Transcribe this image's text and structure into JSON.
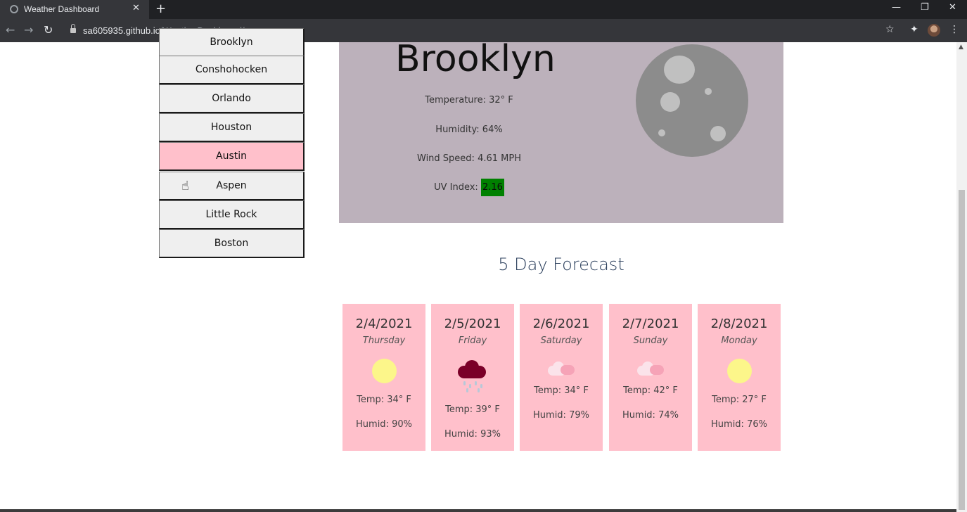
{
  "browser": {
    "tab_title": "Weather Dashboard",
    "tab_close": "✕",
    "new_tab": "+",
    "url_host": "sa605935.github.io",
    "url_path": "/WeatherDashboard/",
    "back": "←",
    "forward": "→",
    "reload": "↻",
    "star": "☆",
    "extensions": "✦",
    "menu": "⋮",
    "minimize": "—",
    "restore": "❐",
    "close": "✕"
  },
  "cities": [
    {
      "label": "Brooklyn"
    },
    {
      "label": "Conshohocken"
    },
    {
      "label": "Orlando"
    },
    {
      "label": "Houston"
    },
    {
      "label": "Austin",
      "active": true
    },
    {
      "label": "Aspen"
    },
    {
      "label": "Little Rock"
    },
    {
      "label": "Boston"
    }
  ],
  "current": {
    "city": "Brooklyn",
    "temperature": "Temperature: 32° F",
    "humidity": "Humidity: 64%",
    "wind": "Wind Speed: 4.61 MPH",
    "uv_label": "UV Index:",
    "uv_value": "2.16",
    "uv_color": "#008000",
    "icon": "moon-icon"
  },
  "forecast": {
    "title": "5 Day Forecast",
    "days": [
      {
        "date": "2/4/2021",
        "day": "Thursday",
        "icon": "sun-icon",
        "temp": "Temp: 34° F",
        "humid": "Humid: 90%"
      },
      {
        "date": "2/5/2021",
        "day": "Friday",
        "icon": "rain-cloud-icon",
        "temp": "Temp: 39° F",
        "humid": "Humid: 93%"
      },
      {
        "date": "2/6/2021",
        "day": "Saturday",
        "icon": "cloud-icon",
        "temp": "Temp: 34° F",
        "humid": "Humid: 79%"
      },
      {
        "date": "2/7/2021",
        "day": "Sunday",
        "icon": "cloud-icon",
        "temp": "Temp: 42° F",
        "humid": "Humid: 74%"
      },
      {
        "date": "2/8/2021",
        "day": "Monday",
        "icon": "sun-icon",
        "temp": "Temp: 27° F",
        "humid": "Humid: 76%"
      }
    ]
  },
  "colors": {
    "card_bg": "#ffc0cb",
    "current_bg": "#bcb1bb",
    "active_city": "#ffc0cb"
  }
}
